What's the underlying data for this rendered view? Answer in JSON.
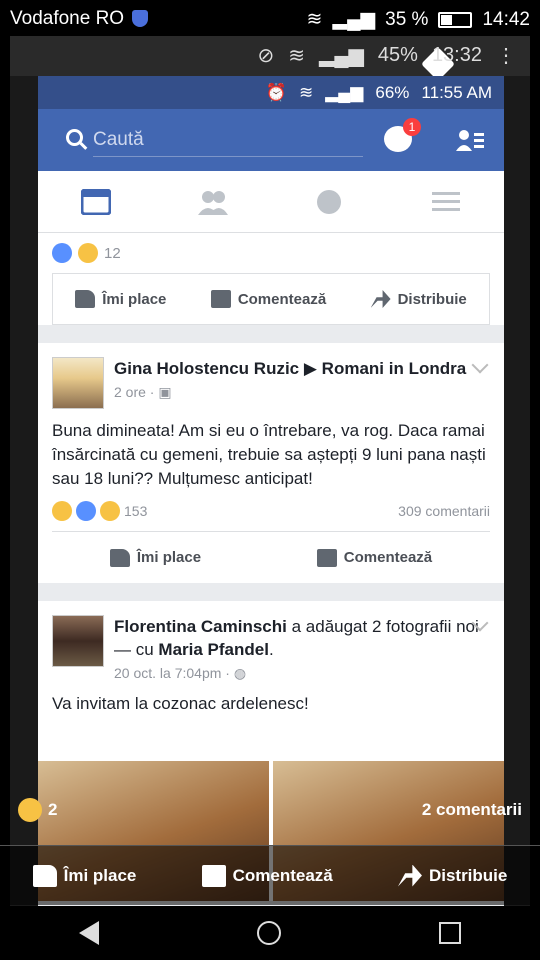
{
  "outer_status": {
    "carrier": "Vodafone RO",
    "battery": "35 %",
    "time": "14:42",
    "battery_level": 0.35
  },
  "inner_status": {
    "battery": "45%",
    "time": "13:32"
  },
  "fb_status": {
    "battery": "66%",
    "time": "11:55 AM"
  },
  "header": {
    "search_placeholder": "Caută",
    "messenger_badge": "1"
  },
  "tabs": [
    {
      "icon": "news-feed-icon"
    },
    {
      "icon": "friends-icon"
    },
    {
      "icon": "globe-icon"
    },
    {
      "icon": "menu-icon"
    }
  ],
  "posts": [
    {
      "reaction_count": "12",
      "actions": {
        "like": "Îmi place",
        "comment": "Comentează",
        "share": "Distribuie"
      }
    },
    {
      "author": "Gina Holostencu Ruzic",
      "group": "Romani in Londra",
      "time": "2 ore",
      "text": "Buna dimineata! Am si eu o întrebare, va rog. Daca ramai însărcinată cu gemeni, trebuie sa aștepți 9 luni pana naști sau 18 luni?? Mulțumesc anticipat!",
      "reaction_count": "153",
      "comments": "309 comentarii",
      "actions": {
        "like": "Îmi place",
        "comment": "Comentează"
      }
    },
    {
      "author": "Florentina Caminschi",
      "action_text": "a adăugat 2 fotografii noi — cu",
      "tagged": "Maria Pfandel",
      "time": "20 oct. la 7:04pm",
      "text": "Va invitam la cozonac ardelenesc!"
    }
  ],
  "overlay": {
    "reaction_count": "2",
    "comments": "2 comentarii",
    "actions": {
      "like": "Îmi place",
      "comment": "Comentează",
      "share": "Distribuie"
    }
  }
}
